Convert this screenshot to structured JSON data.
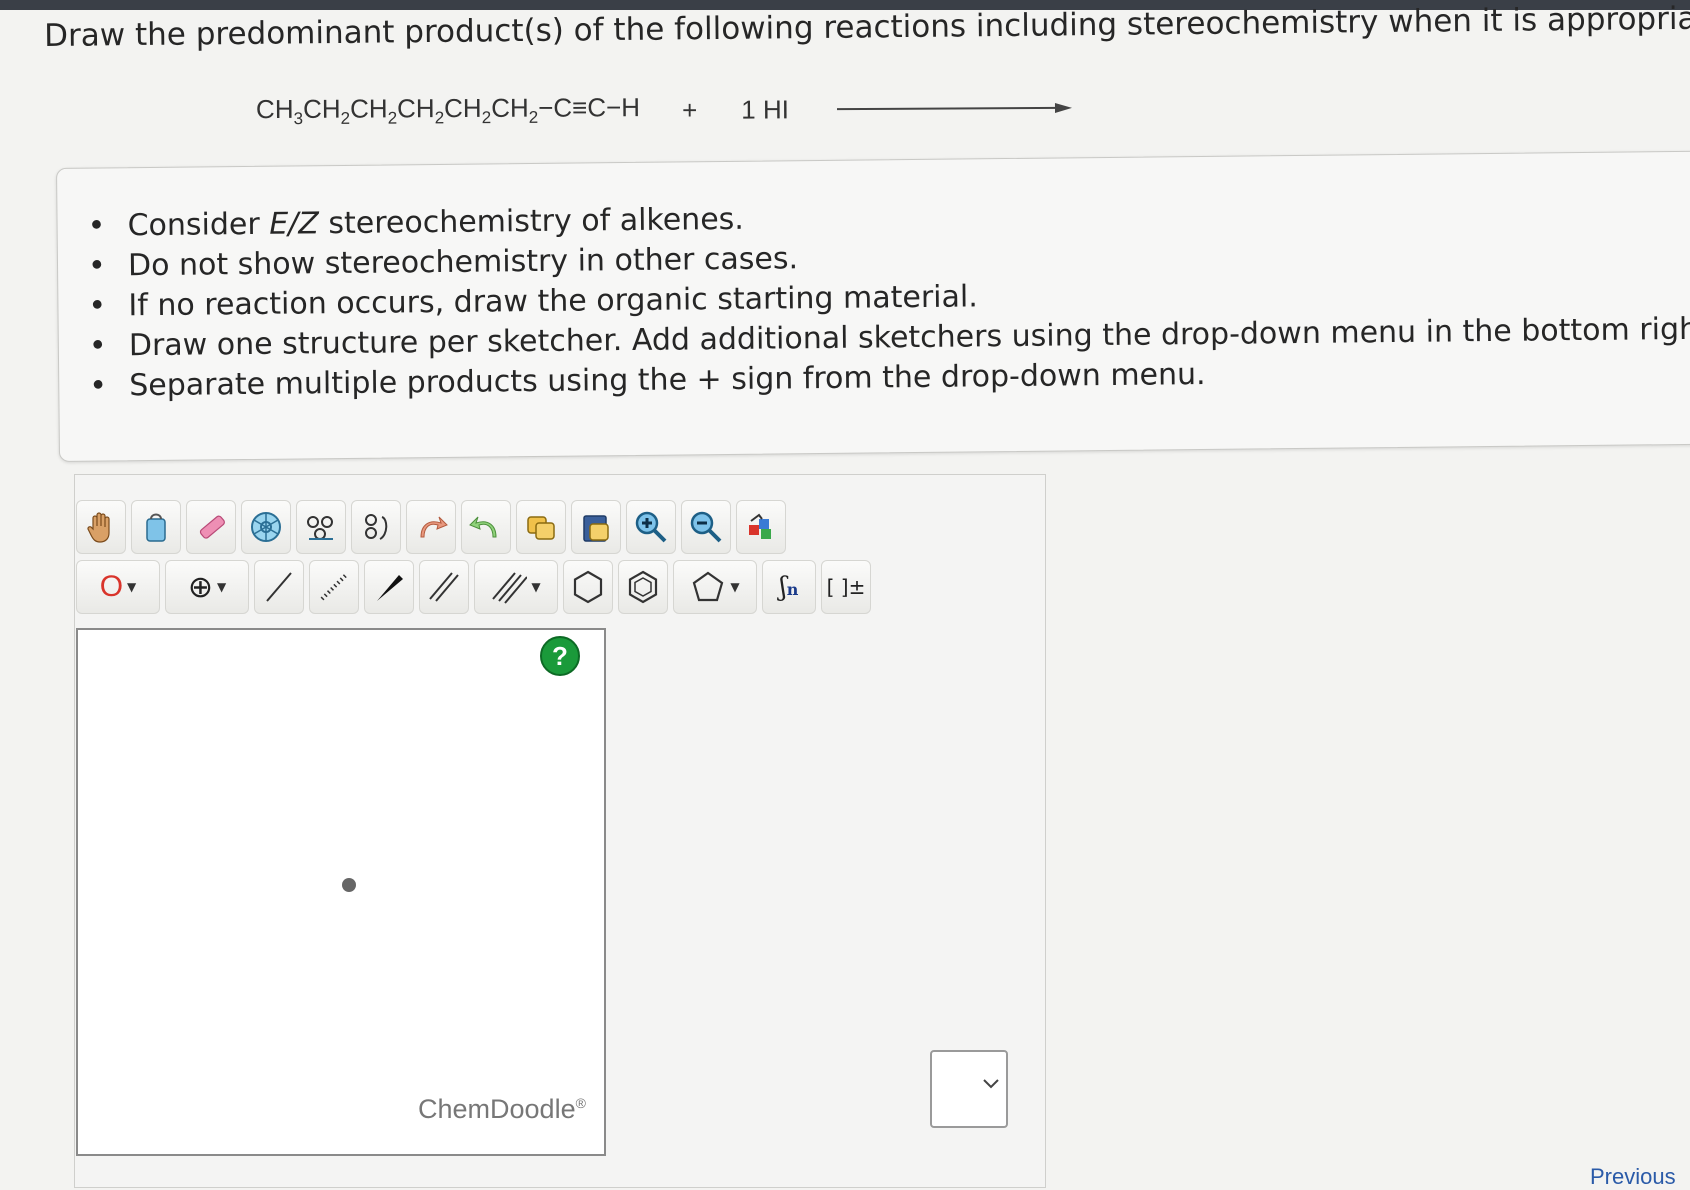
{
  "question": "Draw the predominant product(s) of the following reactions including stereochemistry when it is appropriate.",
  "reaction": {
    "reactant_parts": [
      "CH",
      "3",
      "CH",
      "2",
      "CH",
      "2",
      "CH",
      "2",
      "CH",
      "2",
      "CH",
      "2",
      "−C≡C−H"
    ],
    "plus": "+",
    "reagent": "1 HI"
  },
  "instructions": {
    "item1_pre": "Consider ",
    "item1_em": "E/Z",
    "item1_post": " stereochemistry of alkenes.",
    "item2": "Do not show stereochemistry in other cases.",
    "item3": "If no reaction occurs, draw the organic starting material.",
    "item4": "Draw one structure per sketcher. Add additional sketchers using the drop-down menu in the bottom right co",
    "item5": "Separate multiple products using the + sign from the drop-down menu."
  },
  "toolbar": {
    "atom_label": "O",
    "charge_label": "⊕",
    "sgroup_label": "n",
    "bracket_label": "[ ]±"
  },
  "sketcher": {
    "help_label": "?",
    "brand": "ChemDoodle",
    "brand_mark": "®"
  },
  "nav": {
    "previous": "Previous"
  },
  "colors": {
    "accent_green": "#1a9a3a",
    "atom_red": "#d9342b",
    "link_blue": "#2a5aa8"
  }
}
